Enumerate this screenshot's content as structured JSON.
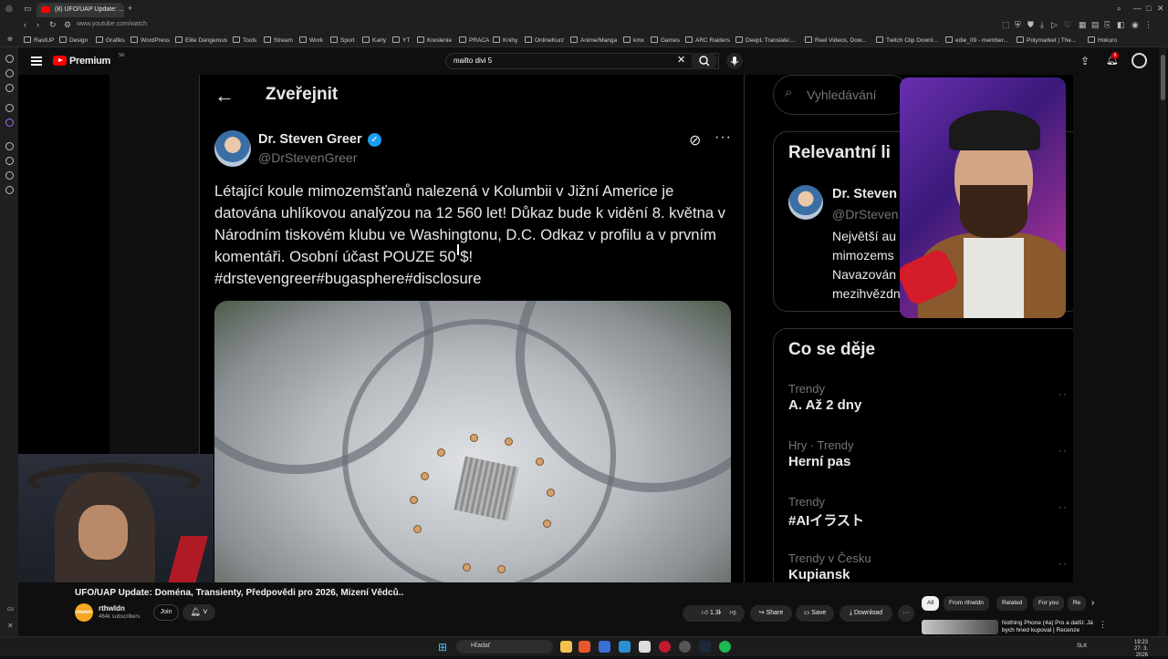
{
  "browser": {
    "tab_title": "(8) UFO/UAP Update: ...",
    "url": "www.youtube.com/watch",
    "bookmarks": [
      "RastUP",
      "Design",
      "Grafiks",
      "WordPress",
      "Elite Dangerous",
      "Tools",
      "Stream",
      "Work",
      "Sport",
      "Karty",
      "YT",
      "Kreslenie",
      "PRACA",
      "Knihy",
      "OnlineKurz",
      "Anime/Manga",
      "kmx",
      "Games",
      "ARC Raiders",
      "DeepL Translate:...",
      "Reel Videos, Dow...",
      "Twitch Clip Downl...",
      "edie_09 - member...",
      "Polymarket | The...",
      "Hokuro"
    ]
  },
  "youtube": {
    "brand": "Premium",
    "region": "SK",
    "search_value": "mailto divi 5",
    "notification_count": "6",
    "video_title": "UFO/UAP Update: Doména, Transienty, Předpovědi pro 2026, Mizení Vědců..",
    "channel": {
      "avatar_text": "rthwldn",
      "name": "rthwldn",
      "subscribers": "464k subscribers"
    },
    "join_label": "Join",
    "like_count": "1.3k",
    "share_label": "Share",
    "save_label": "Save",
    "download_label": "Download",
    "chips": [
      "All",
      "From rthwldn",
      "Related",
      "For you",
      "Re"
    ],
    "recommended": {
      "title": "Nothing Phone (4a) Pro a další: Já bych hned kupoval | Recenze"
    },
    "side_label": "GX"
  },
  "tweet": {
    "header_title": "Zveřejnit",
    "author_name": "Dr. Steven Greer",
    "author_handle": "@DrStevenGreer",
    "text": "Létající koule mimozemšťanů nalezená v Kolumbii v Jižní Americe je datována uhlíkovou analýzou na 12 560 let! Důkaz bude k vidění 8. května v Národním tiskovém klubu ve Washingtonu, D.C. Odkaz v profilu a v prvním komentáři. Osobní účast POUZE 50 $! #drstevengreer#bugasphere#disclosure"
  },
  "x_sidebar": {
    "search_placeholder": "Vyhledávání",
    "relevant_title": "Relevantní li",
    "relevant_name": "Dr. Steven",
    "relevant_handle": "@DrSteven",
    "relevant_bio_1": "Největší au",
    "relevant_bio_2": "mimozems",
    "relevant_bio_3": "Navazován",
    "relevant_bio_4": "mezihvězdn",
    "trends_title": "Co se děje",
    "trends": [
      {
        "category": "Trendy",
        "name": "A. Až 2 dny"
      },
      {
        "category": "Hry · Trendy",
        "name": "Herní pas"
      },
      {
        "category": "Trendy",
        "name": "#AIイラスト"
      },
      {
        "category": "Trendy v Česku",
        "name": "Kupiansk"
      }
    ]
  },
  "overlay": {
    "watermark": "rTuWdn"
  },
  "taskbar": {
    "search_label": "Hľadať",
    "language": "SLK",
    "time": "19:23",
    "date": "27. 3. 2026"
  },
  "colors": {
    "youtube_red": "#ff0000",
    "x_verified_blue": "#1d9bf0",
    "background": "#0f0f0f"
  }
}
